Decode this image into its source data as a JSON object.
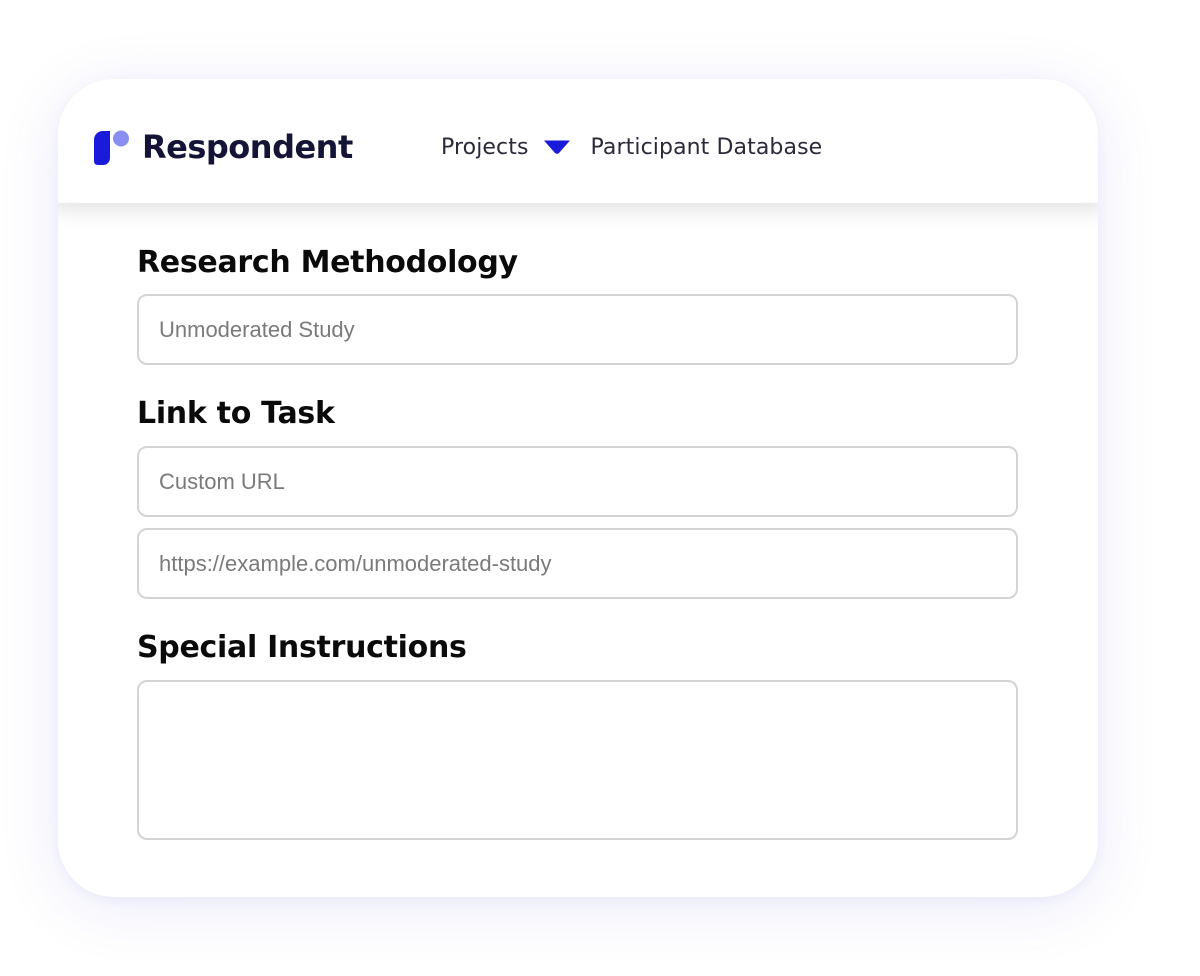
{
  "header": {
    "brand": "Respondent",
    "logo_icon": "respondent-logo-icon",
    "brand_color": "#1a1adb",
    "nav": {
      "projects_label": "Projects",
      "dropdown_icon": "chevron-down-icon",
      "participant_db_label": "Participant Database"
    }
  },
  "form": {
    "methodology": {
      "label": "Research Methodology",
      "placeholder": "Unmoderated Study"
    },
    "task_link": {
      "label": "Link to Task",
      "type_placeholder": "Custom URL",
      "url_placeholder": "https://example.com/unmoderated-study"
    },
    "special_instructions": {
      "label": "Special Instructions",
      "placeholder": ""
    }
  }
}
